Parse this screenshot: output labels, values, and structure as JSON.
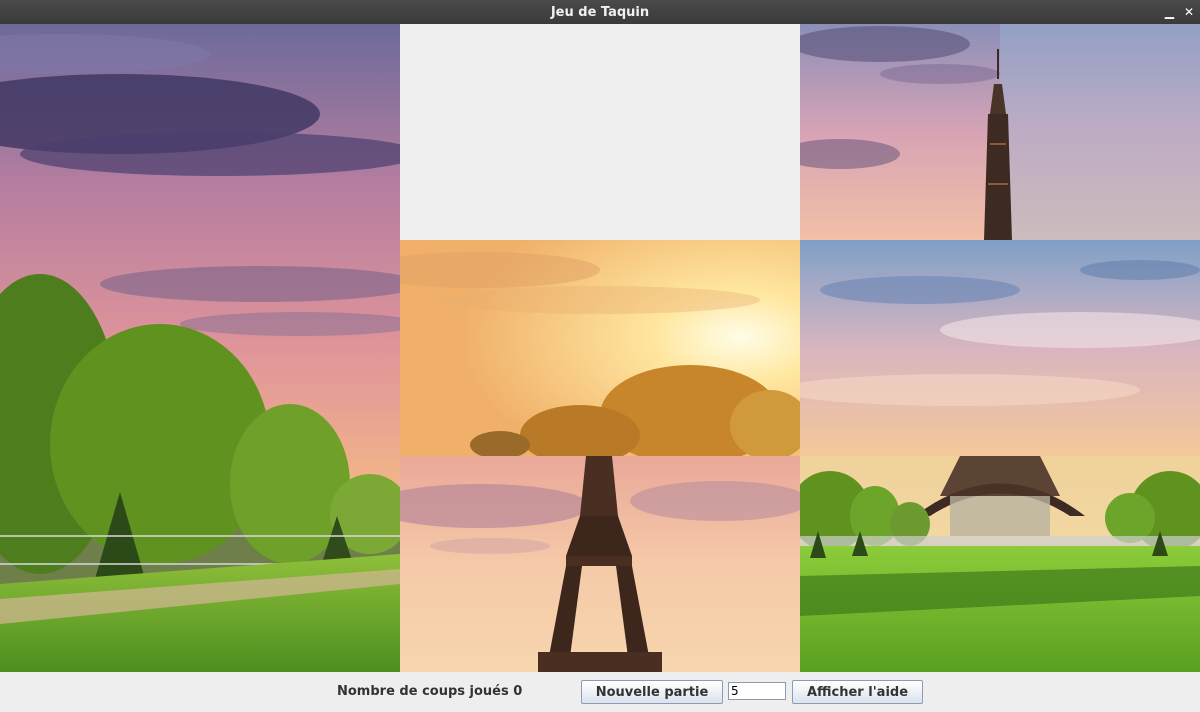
{
  "window": {
    "title": "Jeu de Taquin",
    "minimize_glyph": "▁",
    "close_glyph": "✕"
  },
  "board": {
    "rows": 3,
    "cols": 3,
    "empty_tile": {
      "row": 1,
      "col": 2
    }
  },
  "status": {
    "moves_label": "Nombre de coups joués 0",
    "new_game_label": "Nouvelle partie",
    "size_value": "5",
    "help_label": "Afficher l'aide"
  },
  "colors": {
    "titlebar": "#3c3c3c",
    "background": "#eeeeee",
    "empty_tile": "#efefef"
  }
}
